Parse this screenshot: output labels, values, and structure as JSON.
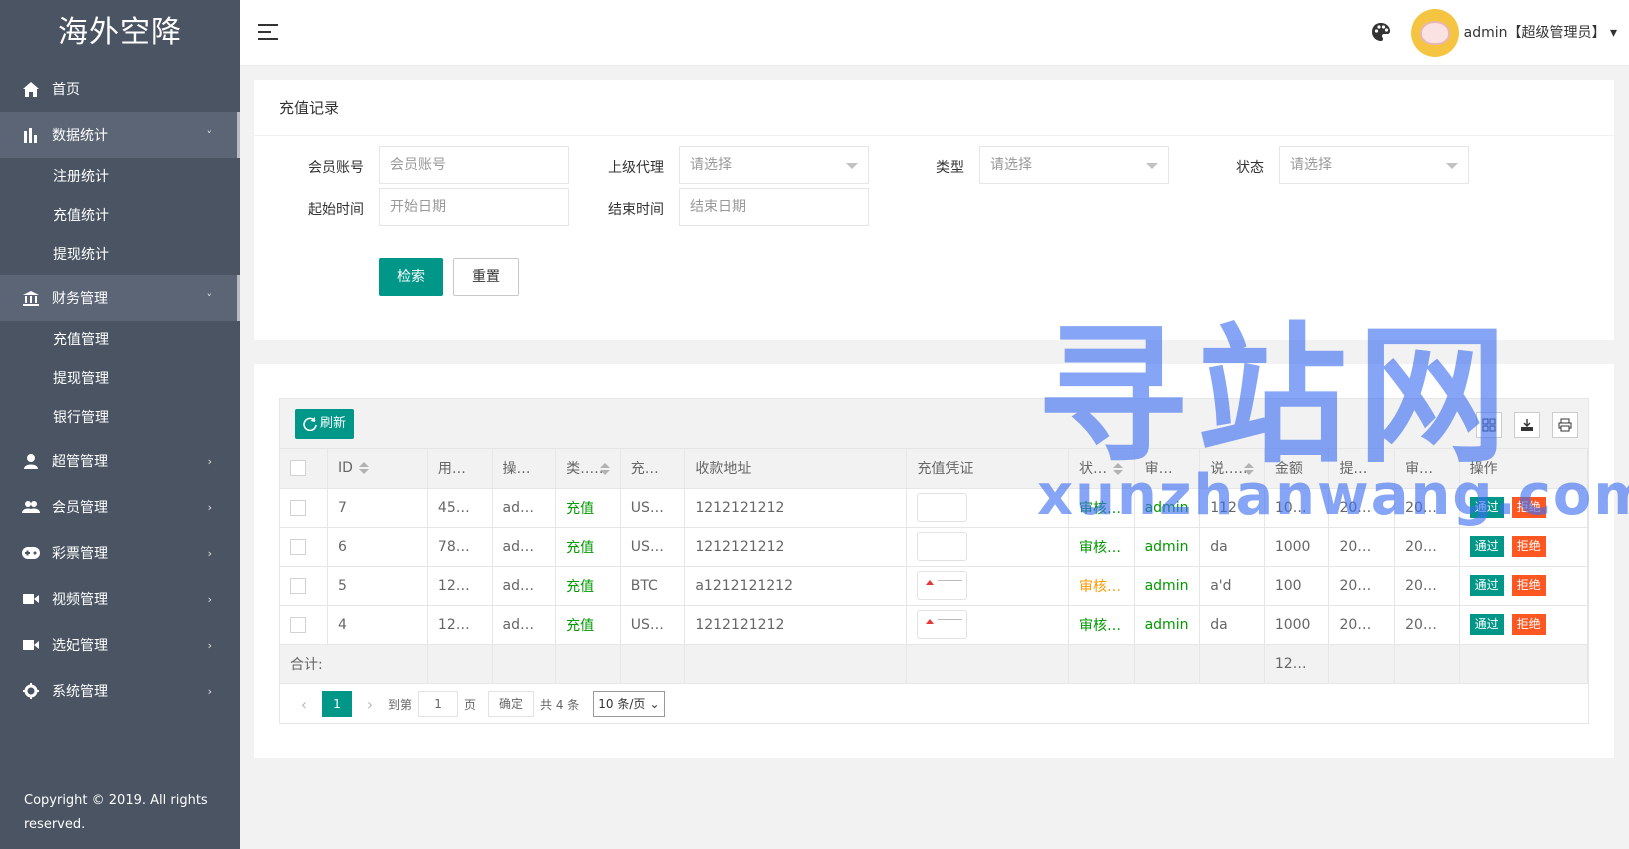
{
  "app": {
    "logo": "海外空降"
  },
  "sidebar": {
    "items": [
      {
        "label": "首页",
        "icon": "home-icon"
      },
      {
        "label": "数据统计",
        "icon": "bar-chart-icon",
        "arrow": "˅",
        "children": [
          "注册统计",
          "充值统计",
          "提现统计"
        ]
      },
      {
        "label": "财务管理",
        "icon": "bank-icon",
        "arrow": "˅",
        "children": [
          "充值管理",
          "提现管理",
          "银行管理"
        ]
      },
      {
        "label": "超管管理",
        "icon": "user-icon",
        "arrow": "›"
      },
      {
        "label": "会员管理",
        "icon": "users-icon",
        "arrow": "›"
      },
      {
        "label": "彩票管理",
        "icon": "gamepad-icon",
        "arrow": "›"
      },
      {
        "label": "视频管理",
        "icon": "video-icon",
        "arrow": "›"
      },
      {
        "label": "选妃管理",
        "icon": "video-icon",
        "arrow": "›"
      },
      {
        "label": "系统管理",
        "icon": "gear-icon",
        "arrow": "›"
      }
    ],
    "copyright": "Copyright © 2019. All rights reserved."
  },
  "header": {
    "user": "admin【超级管理员】",
    "caret": "▾"
  },
  "search": {
    "title": "充值记录",
    "account_label": "会员账号",
    "account_placeholder": "会员账号",
    "agent_label": "上级代理",
    "agent_value": "请选择",
    "type_label": "类型",
    "type_value": "请选择",
    "status_label": "状态",
    "status_value": "请选择",
    "start_label": "起始时间",
    "start_placeholder": "开始日期",
    "end_label": "结束时间",
    "end_placeholder": "结束日期",
    "search_btn": "检索",
    "reset_btn": "重置"
  },
  "table": {
    "refresh": "刷新",
    "headers": [
      "ID",
      "用…",
      "操…",
      "类…",
      "充…",
      "收款地址",
      "充值凭证",
      "状…",
      "审…",
      "说…",
      "金额",
      "提…",
      "审…",
      "操作"
    ],
    "rows": [
      {
        "id": "7",
        "user": "45…",
        "op": "ad…",
        "type": "充值",
        "currency": "US…",
        "address": "1212121212",
        "status": "审核通过",
        "reviewer": "admin",
        "note": "112",
        "amount": "10…",
        "t1": "20…",
        "t2": "20…"
      },
      {
        "id": "6",
        "user": "78…",
        "op": "ad…",
        "type": "充值",
        "currency": "US…",
        "address": "1212121212",
        "status": "审核通过",
        "reviewer": "admin",
        "note": "da",
        "amount": "1000",
        "t1": "20…",
        "t2": "20…"
      },
      {
        "id": "5",
        "user": "12…",
        "op": "ad…",
        "type": "充值",
        "currency": "BTC",
        "address": "a1212121212",
        "status": "审核拒绝",
        "reviewer": "admin",
        "note": "a'd",
        "amount": "100",
        "t1": "20…",
        "t2": "20…"
      },
      {
        "id": "4",
        "user": "12…",
        "op": "ad…",
        "type": "充值",
        "currency": "US…",
        "address": "1212121212",
        "status": "审核通过",
        "reviewer": "admin",
        "note": "da",
        "amount": "1000",
        "t1": "20…",
        "t2": "20…"
      }
    ],
    "pass": "通过",
    "reject": "拒绝",
    "total_label": "合计:",
    "total_amount": "12…"
  },
  "pager": {
    "current": "1",
    "goto_label": "到第",
    "goto_value": "1",
    "page_label": "页",
    "confirm": "确定",
    "total": "共 4 条",
    "size": "10 条/页"
  },
  "watermark": {
    "big": "寻站网",
    "small": "xunzhanwang.com"
  }
}
